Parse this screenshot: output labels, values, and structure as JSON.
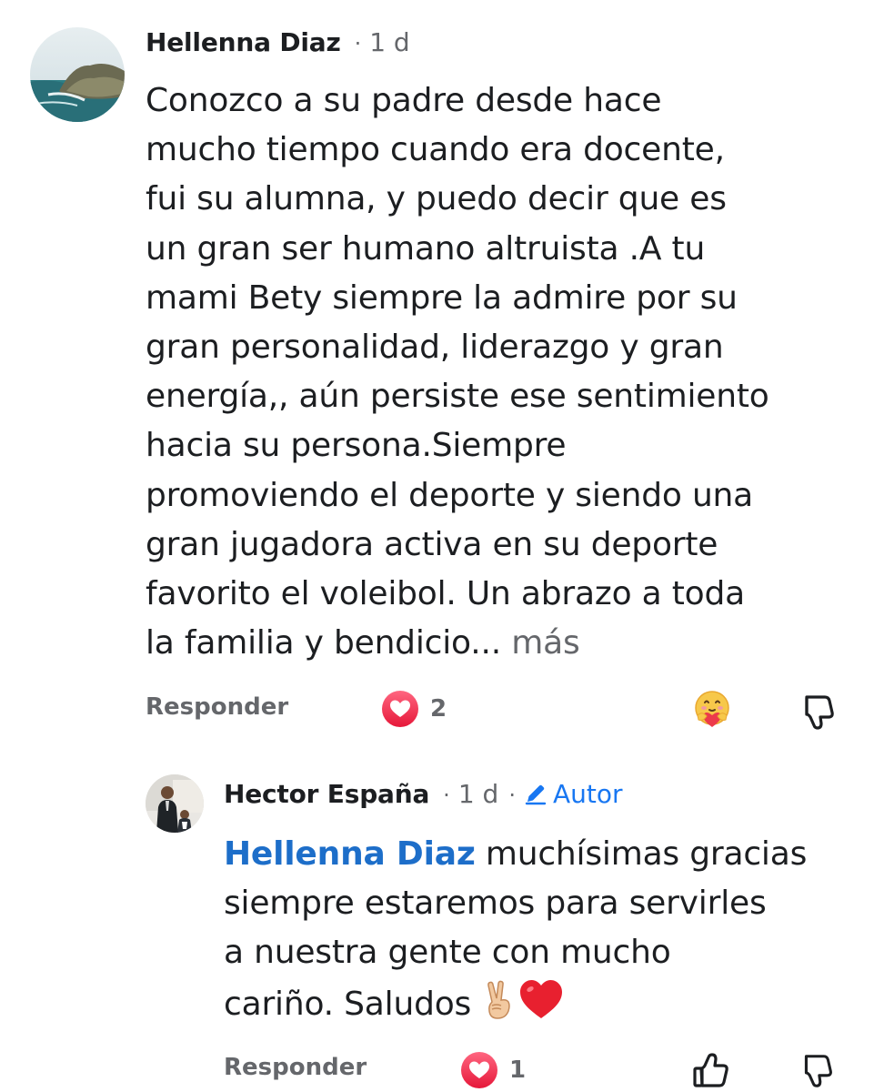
{
  "comment": {
    "author": "Hellenna Diaz",
    "separator": "·",
    "time": "1 d",
    "text_lines": [
      "Conozco a su padre desde hace",
      "mucho tiempo cuando era docente,",
      "fui su alumna, y puedo decir que es",
      "un gran ser humano altruista .A tu",
      "mami Bety siempre la admire por su",
      "gran personalidad, liderazgo y gran",
      "energía,, aún persiste ese sentimiento",
      "hacia su persona.Siempre",
      "promoviendo el deporte y siendo una",
      "gran jugadora activa en su deporte",
      "favorito el voleibol. Un abrazo a toda"
    ],
    "last_line": "la familia y bendicio...",
    "more_label": "más",
    "reply_label": "Responder",
    "reaction_icon": "love-reaction",
    "reaction_count": "2",
    "care_icon": "care-emoji-icon",
    "dislike_icon": "thumbs-down-icon"
  },
  "reply": {
    "author": "Hector España",
    "separator": "·",
    "time": "1 d",
    "separator2": "·",
    "badge_label": "Autor",
    "badge_icon": "pencil-icon",
    "mention": "Hellenna Diaz",
    "text_first": "muchísimas gracias",
    "text_lines": [
      "siempre estaremos para servirles",
      "a nuestra gente con mucho"
    ],
    "last_line": "cariño. Saludos",
    "emojis": [
      "victory-hand",
      "red-heart"
    ],
    "reply_label": "Responder",
    "reaction_icon": "love-reaction",
    "reaction_count": "1",
    "like_icon": "thumbs-up-icon",
    "dislike_icon": "thumbs-down-icon"
  },
  "colors": {
    "text": "#1c1e21",
    "secondary": "#65676b",
    "link": "#1877f2",
    "love": "#f33e58"
  }
}
